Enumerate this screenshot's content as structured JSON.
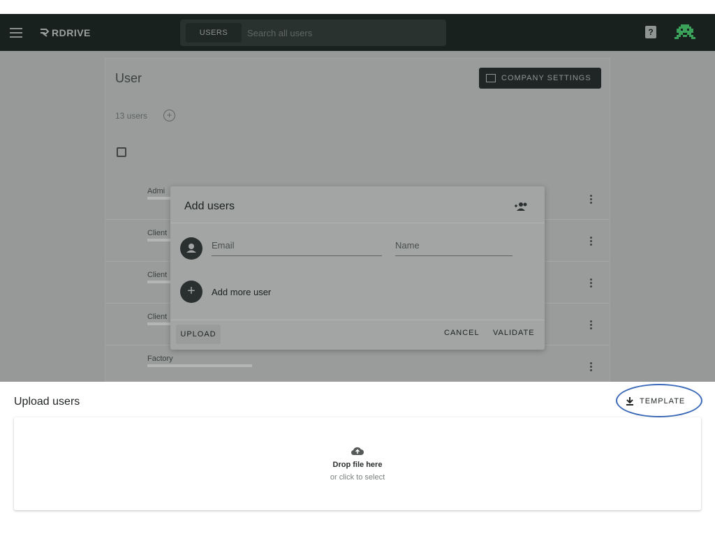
{
  "app": {
    "brand": "RDRIVE",
    "search_chip": "USERS",
    "search_placeholder": "Search all users",
    "help_label": "?"
  },
  "users_page": {
    "title": "User",
    "company_settings_label": "COMPANY SETTINGS",
    "users_count": "13 users",
    "rows": [
      {
        "name": "Admi"
      },
      {
        "name": "Client"
      },
      {
        "name": "Client"
      },
      {
        "name": "Client"
      },
      {
        "name": "Factory"
      }
    ]
  },
  "dialog": {
    "title": "Add users",
    "email_label": "Email",
    "name_label": "Name",
    "add_more_label": "Add more user",
    "upload_label": "UPLOAD",
    "cancel_label": "CANCEL",
    "validate_label": "VALIDATE"
  },
  "upload_sheet": {
    "title": "Upload users",
    "template_label": "TEMPLATE",
    "drop_title": "Drop file here",
    "drop_subtitle": "or click to select"
  },
  "colors": {
    "appbar": "#19211f",
    "highlight": "#3b6ab8",
    "overlay": "#969998"
  }
}
